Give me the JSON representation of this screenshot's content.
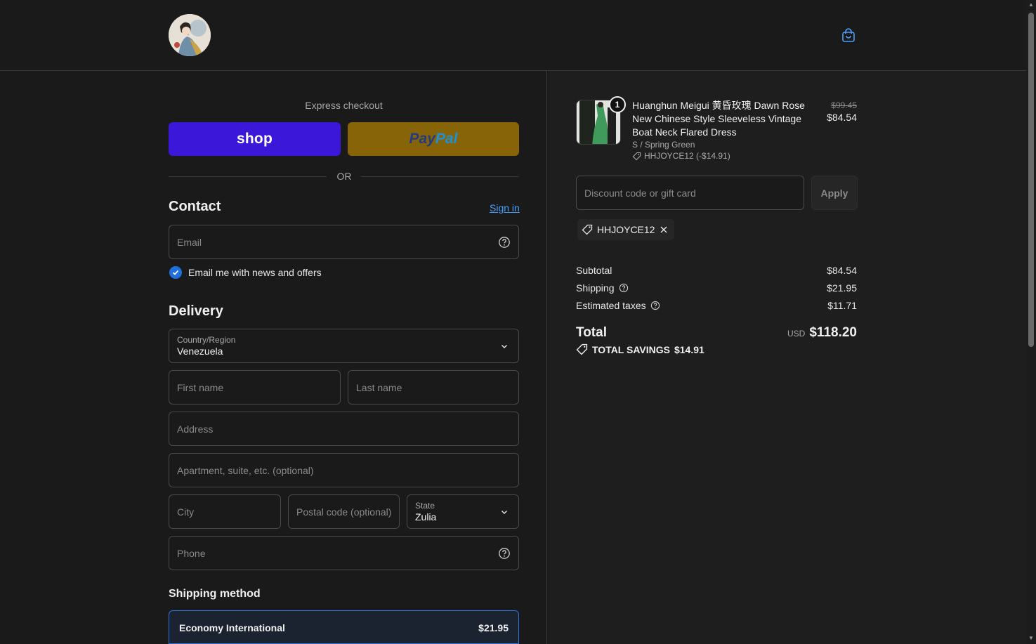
{
  "header": {
    "logo_alt": "store-logo",
    "cart_icon": "shopping-bag-icon"
  },
  "express": {
    "title": "Express checkout",
    "shop_label": "shop",
    "paypal_part1": "Pay",
    "paypal_part2": "Pal",
    "or_label": "OR"
  },
  "contact": {
    "heading": "Contact",
    "signin_label": "Sign in",
    "email_placeholder": "Email",
    "newsletter_label": "Email me with news and offers",
    "newsletter_checked": true
  },
  "delivery": {
    "heading": "Delivery",
    "country_label": "Country/Region",
    "country_value": "Venezuela",
    "first_name_placeholder": "First name",
    "last_name_placeholder": "Last name",
    "address_placeholder": "Address",
    "apartment_placeholder": "Apartment, suite, etc. (optional)",
    "city_placeholder": "City",
    "postal_placeholder": "Postal code (optional)",
    "state_label": "State",
    "state_value": "Zulia",
    "phone_placeholder": "Phone"
  },
  "shipping": {
    "heading": "Shipping method",
    "option_name": "Economy International",
    "option_price": "$21.95"
  },
  "summary": {
    "item": {
      "quantity": "1",
      "name": "Huanghun Meigui 黄昏玫瑰 Dawn Rose New Chinese Style Sleeveless Vintage Boat Neck Flared Dress",
      "variant": "S / Spring Green",
      "discount": "HHJOYCE12 (-$14.91)",
      "original_price": "$99.45",
      "price": "$84.54"
    },
    "discount_placeholder": "Discount code or gift card",
    "apply_label": "Apply",
    "applied_code": "HHJOYCE12",
    "subtotal_label": "Subtotal",
    "subtotal_value": "$84.54",
    "shipping_label": "Shipping",
    "shipping_value": "$21.95",
    "taxes_label": "Estimated taxes",
    "taxes_value": "$11.71",
    "total_label": "Total",
    "currency": "USD",
    "total_value": "$118.20",
    "savings_label": "TOTAL SAVINGS",
    "savings_value": "$14.91"
  },
  "colors": {
    "accent": "#1f6fdc",
    "shop": "#3a17d9",
    "paypal": "#876408",
    "link": "#4a9fff"
  }
}
